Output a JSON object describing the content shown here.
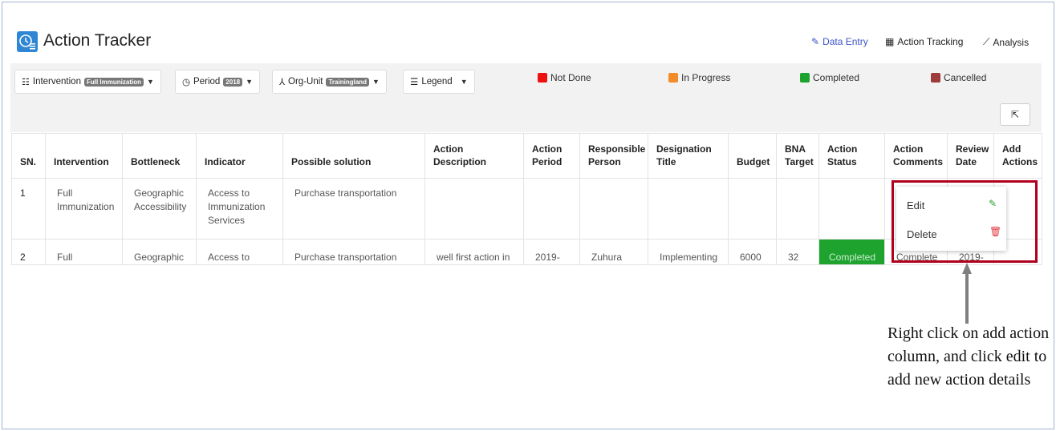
{
  "app": {
    "title": "Action Tracker",
    "logo_icon": "clock-list-icon",
    "accent": "#2e86d4"
  },
  "nav": [
    {
      "label": "Data Entry",
      "icon": "pencil-icon",
      "active": true
    },
    {
      "label": "Action Tracking",
      "icon": "table-icon",
      "active": false
    },
    {
      "label": "Analysis",
      "icon": "chart-line-icon",
      "active": false
    }
  ],
  "filters": {
    "intervention": {
      "label": "Intervention",
      "value": "Full Immunization"
    },
    "period": {
      "label": "Period",
      "value": "2018"
    },
    "orgunit": {
      "label": "Org-Unit",
      "value": "Trainingland"
    },
    "legend": {
      "label": "Legend"
    }
  },
  "legend": [
    {
      "label": "Not Done",
      "color": "#ee1111"
    },
    {
      "label": "In Progress",
      "color": "#f28c28"
    },
    {
      "label": "Completed",
      "color": "#1ea32f"
    },
    {
      "label": "Cancelled",
      "color": "#9e3b3b"
    }
  ],
  "table": {
    "headers": {
      "sn": "SN.",
      "intervention": "Intervention",
      "bottleneck": "Bottleneck",
      "indicator": "Indicator",
      "solution": "Possible solution",
      "action_desc": "Action Description",
      "action_period": "Action Period",
      "responsible": "Responsible Person",
      "designation": "Designation Title",
      "budget": "Budget",
      "bna_target": "BNA Target",
      "action_status": "Action Status",
      "action_comments": "Action Comments",
      "review_date": "Review Date",
      "add_actions": "Add Actions"
    },
    "rows": [
      {
        "sn": "1",
        "intervention": "Full Immunization",
        "bottleneck": "Geographic Accessibility",
        "indicator": "Access to Immunization Services",
        "solution": "Purchase transportation",
        "action_desc": "",
        "action_period": "",
        "responsible": "",
        "designation": "",
        "budget": "",
        "bna_target": "",
        "action_status": "",
        "action_comments": "",
        "review_date": "",
        "add_actions": ""
      },
      {
        "sn": "2",
        "intervention": "Full",
        "bottleneck": "Geographic",
        "indicator": "Access to",
        "solution": "Purchase transportation",
        "action_desc": "well first action in",
        "action_period": "2019-",
        "responsible": "Zuhura",
        "designation": "Implementing",
        "budget": "6000",
        "bna_target": "32",
        "action_status": "Completed",
        "action_comments": "Complete",
        "review_date": "2019-",
        "add_actions": ""
      }
    ]
  },
  "context_menu": {
    "items": [
      {
        "label": "Edit",
        "icon": "pencil-icon",
        "color": "#2e9e2e"
      },
      {
        "label": "Delete",
        "icon": "trash-icon",
        "color": "#e0393e"
      }
    ]
  },
  "annotation": {
    "text": "Right click on add action column, and click edit to add new action details"
  }
}
